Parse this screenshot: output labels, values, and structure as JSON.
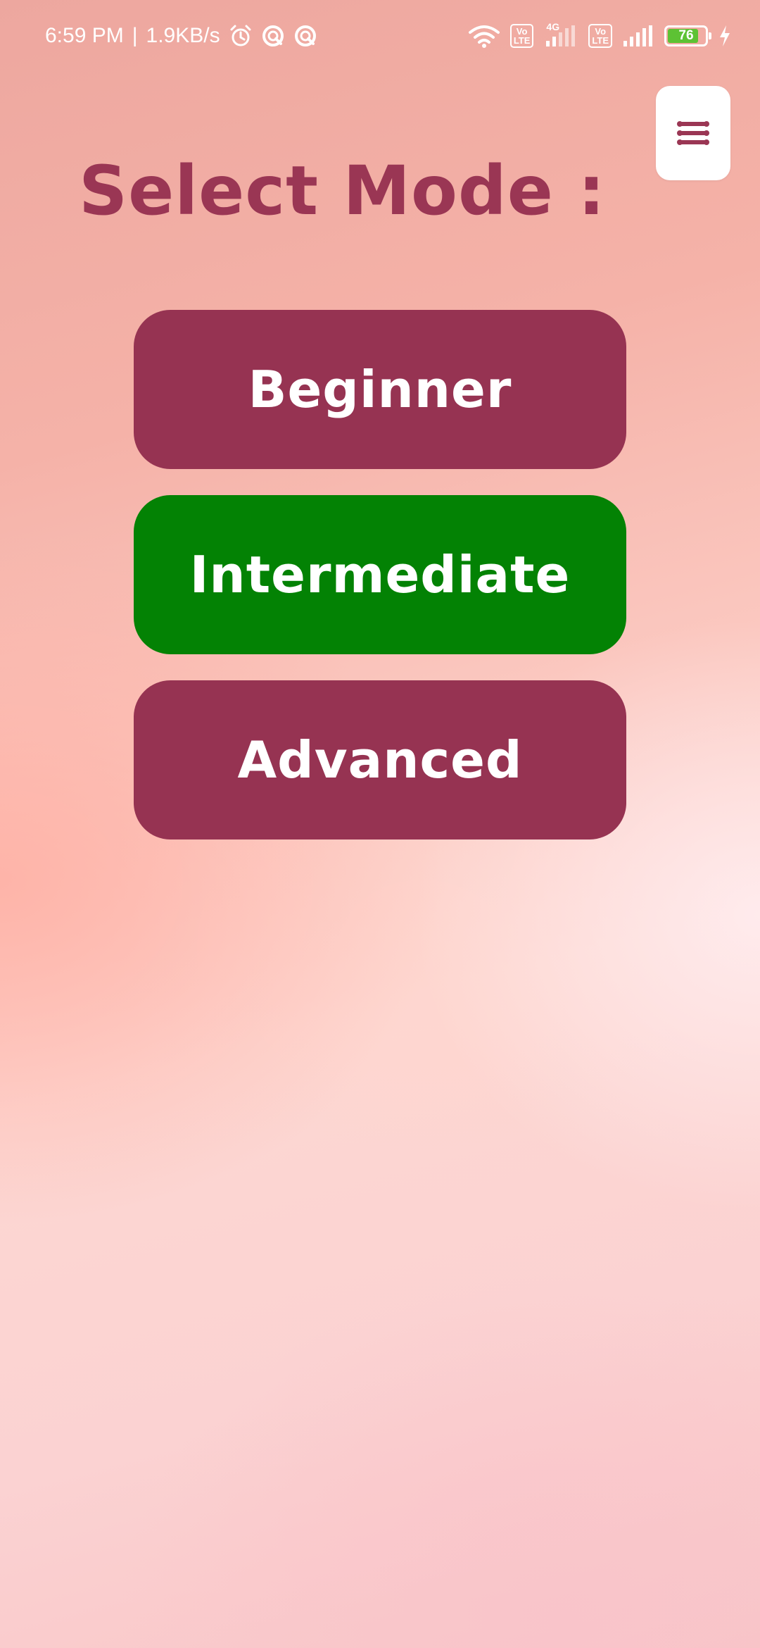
{
  "status_bar": {
    "time": "6:59 PM",
    "separator": "|",
    "net_speed": "1.9KB/s",
    "network_small": "4G",
    "volte_label": "Vo\nLTE",
    "battery_level": "76",
    "battery_percent": 76
  },
  "header": {
    "title": "Select Mode :",
    "menu_icon": "menu-icon"
  },
  "modes": [
    {
      "label": "Beginner",
      "selected": false
    },
    {
      "label": "Intermediate",
      "selected": true
    },
    {
      "label": "Advanced",
      "selected": false
    }
  ],
  "colors": {
    "title": "#9a3654",
    "button": "#963352",
    "button_selected": "#038204",
    "button_text": "#ffffff",
    "battery": "#5dc234"
  }
}
